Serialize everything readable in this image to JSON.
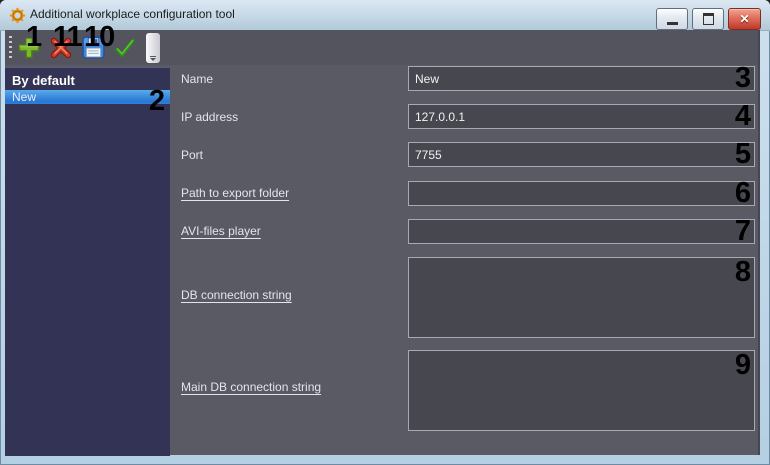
{
  "window": {
    "title": "Additional workplace configuration tool",
    "controls": {
      "minimize": "minimize",
      "maximize": "maximize",
      "close": "close"
    }
  },
  "toolbar": {
    "buttons": [
      {
        "name": "add",
        "icon": "plus-icon"
      },
      {
        "name": "delete",
        "icon": "delete-x-icon"
      },
      {
        "name": "save",
        "icon": "save-floppy-icon"
      },
      {
        "name": "apply",
        "icon": "check-icon"
      }
    ]
  },
  "sidebar": {
    "header": "By default",
    "items": [
      {
        "label": "New",
        "selected": true,
        "annotation": "2"
      }
    ]
  },
  "form": {
    "fields": [
      {
        "label": "Name",
        "value": "New",
        "type": "text",
        "annotation": "3"
      },
      {
        "label": "IP address",
        "value": "127.0.0.1",
        "type": "text",
        "annotation": "4"
      },
      {
        "label": "Port",
        "value": "7755",
        "type": "text",
        "annotation": "5"
      },
      {
        "label": "Path to export folder",
        "value": "",
        "type": "text",
        "annotation": "6"
      },
      {
        "label": "AVI-files player",
        "value": "",
        "type": "text",
        "annotation": "7"
      },
      {
        "label": "DB connection string",
        "value": "",
        "type": "textarea",
        "annotation": "8"
      },
      {
        "label": "Main DB connection string",
        "value": "",
        "type": "textarea",
        "annotation": "9"
      }
    ]
  },
  "annotations": {
    "toolbar_add": "1",
    "toolbar_delete": "11",
    "toolbar_save": "10"
  },
  "colors": {
    "selection_blue": "#2f7fd6",
    "sidebar_bg": "#333356",
    "panel_bg": "#5a5a64",
    "input_bg": "#47474f",
    "input_border": "#a9a9b2",
    "frame_blue": "#bcd6ea",
    "add_green": "#76b82a",
    "delete_red": "#c62f1e",
    "check_green": "#43ad21",
    "save_blue": "#3f87e0",
    "annotation_black": "#000000"
  }
}
